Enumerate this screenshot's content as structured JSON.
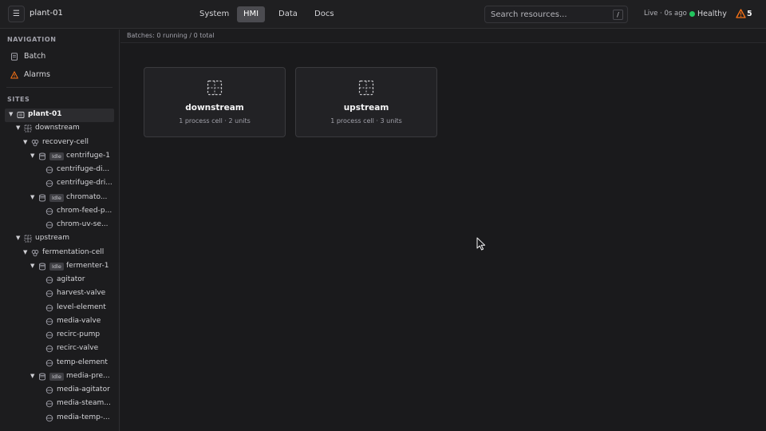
{
  "topbar": {
    "menu_icon": "hamburger-icon",
    "site_name": "plant-01",
    "tabs": [
      "System",
      "HMI",
      "Data",
      "Docs"
    ],
    "active_tab": "HMI",
    "search_placeholder": "Search resources...",
    "search_shortcut": "/",
    "live_status": "Live · 0s ago",
    "health_label": "Healthy",
    "health_color": "#22c55e",
    "alarm_icon": "warning-icon",
    "alarm_count": "5",
    "alarm_color": "#f97316"
  },
  "sidebar": {
    "navigation_heading": "NAVIGATION",
    "nav_items": [
      {
        "label": "Batch",
        "icon": "document-icon"
      },
      {
        "label": "Alarms",
        "icon": "warning-icon"
      }
    ],
    "sites_heading": "SITES",
    "tree": [
      {
        "label": "plant-01",
        "icon": "site-icon",
        "expanded": true,
        "selected": true
      },
      {
        "label": "downstream",
        "icon": "area-icon",
        "expanded": true
      },
      {
        "label": "recovery-cell",
        "icon": "cell-icon",
        "expanded": true
      },
      {
        "label": "centrifuge-1",
        "icon": "unit-icon",
        "badge": "Idle",
        "expanded": true
      },
      {
        "label": "centrifuge-di...",
        "icon": "module-icon"
      },
      {
        "label": "centrifuge-dri...",
        "icon": "module-icon"
      },
      {
        "label": "chromato...",
        "icon": "unit-icon",
        "badge": "Idle",
        "expanded": true
      },
      {
        "label": "chrom-feed-p...",
        "icon": "module-icon"
      },
      {
        "label": "chrom-uv-se...",
        "icon": "module-icon"
      },
      {
        "label": "upstream",
        "icon": "area-icon",
        "expanded": true
      },
      {
        "label": "fermentation-cell",
        "icon": "cell-icon",
        "expanded": true
      },
      {
        "label": "fermenter-1",
        "icon": "unit-icon",
        "badge": "Idle",
        "expanded": true
      },
      {
        "label": "agitator",
        "icon": "module-icon"
      },
      {
        "label": "harvest-valve",
        "icon": "module-icon"
      },
      {
        "label": "level-element",
        "icon": "module-icon"
      },
      {
        "label": "media-valve",
        "icon": "module-icon"
      },
      {
        "label": "recirc-pump",
        "icon": "module-icon"
      },
      {
        "label": "recirc-valve",
        "icon": "module-icon"
      },
      {
        "label": "temp-element",
        "icon": "module-icon"
      },
      {
        "label": "media-pre...",
        "icon": "unit-icon",
        "badge": "Idle",
        "expanded": true
      },
      {
        "label": "media-agitator",
        "icon": "module-icon"
      },
      {
        "label": "media-steam...",
        "icon": "module-icon"
      },
      {
        "label": "media-temp-...",
        "icon": "module-icon"
      }
    ]
  },
  "main": {
    "batch_status": "Batches: 0 running / 0 total",
    "cards": [
      {
        "title": "downstream",
        "subtitle": "1 process cell · 2 units",
        "icon": "area-icon"
      },
      {
        "title": "upstream",
        "subtitle": "1 process cell · 3 units",
        "icon": "area-icon"
      }
    ]
  }
}
